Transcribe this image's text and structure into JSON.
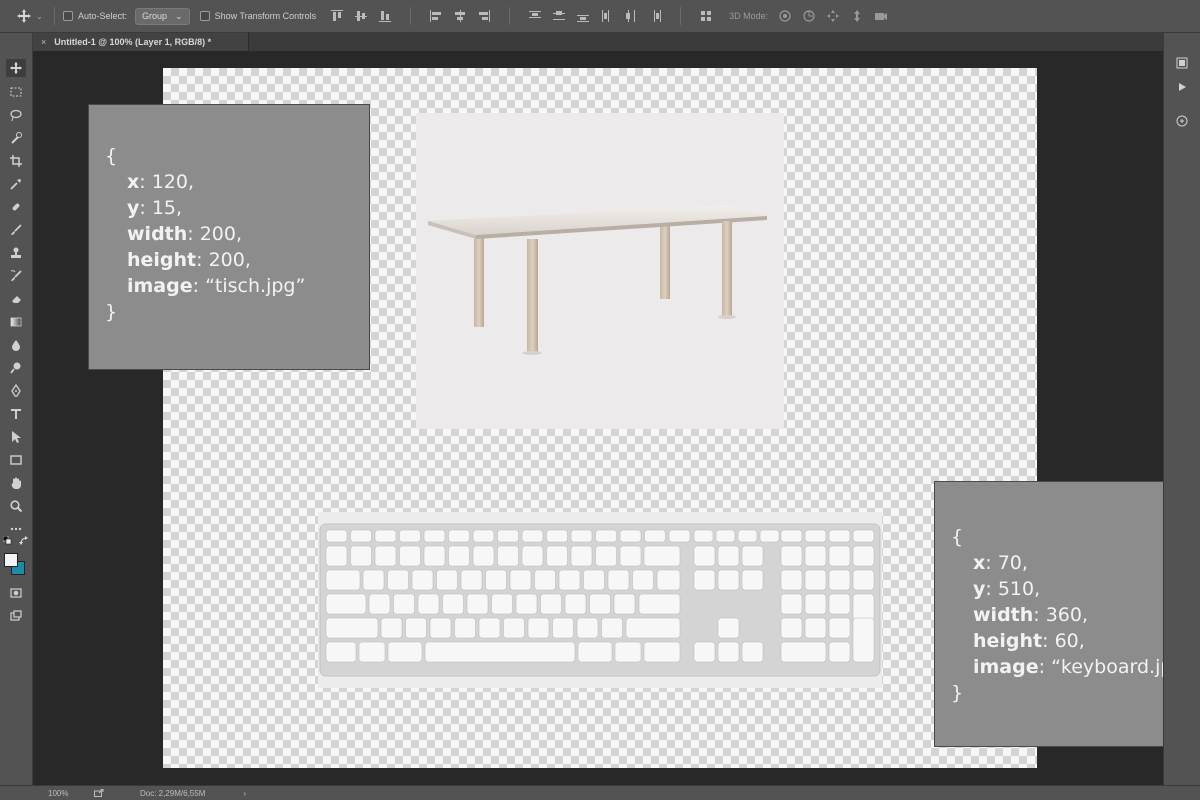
{
  "options_bar": {
    "auto_select_label": "Auto-Select:",
    "auto_select_value": "Group",
    "transform_controls_label": "Show Transform Controls",
    "mode_3d_label": "3D Mode:"
  },
  "document_tab": {
    "title": "Untitled-1 @ 100% (Layer 1, RGB/8) *",
    "close_glyph": "×"
  },
  "status_bar": {
    "zoom": "100%",
    "doc_info": "Doc: 2,29M/6,55M",
    "arrow": "›"
  },
  "overlays": [
    {
      "open": "{",
      "lines": [
        {
          "key": "x",
          "value": ": 120,"
        },
        {
          "key": "y",
          "value": ": 15,"
        },
        {
          "key": "width",
          "value": ": 200,"
        },
        {
          "key": "height",
          "value": ": 200,"
        },
        {
          "key": "image",
          "value": ": “tisch.jpg”"
        }
      ],
      "close": "}"
    },
    {
      "open": "{",
      "lines": [
        {
          "key": "x",
          "value": ": 70,"
        },
        {
          "key": "y",
          "value": ": 510,"
        },
        {
          "key": "width",
          "value": ": 360,"
        },
        {
          "key": "height",
          "value": ": 60,"
        },
        {
          "key": "image",
          "value": ": “keyboard.jpg”"
        }
      ],
      "close": "}"
    }
  ],
  "colors": {
    "foreground": "#f4f4f4",
    "background": "#1d8aa6",
    "ui_panel": "#535353",
    "pasteboard": "#282828"
  }
}
